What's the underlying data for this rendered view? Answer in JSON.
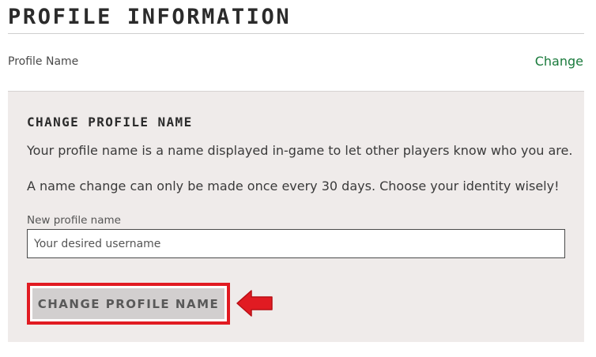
{
  "section": {
    "title": "PROFILE INFORMATION"
  },
  "profile_row": {
    "label": "Profile Name",
    "change_link": "Change"
  },
  "change_panel": {
    "title": "CHANGE PROFILE NAME",
    "description_1": "Your profile name is a name displayed in-game to let other players know who you are.",
    "description_2": "A name change can only be made once every 30 days. Choose your identity wisely!",
    "field_label": "New profile name",
    "input_value": "",
    "input_placeholder": "Your desired username",
    "button_label": "CHANGE PROFILE NAME"
  },
  "colors": {
    "accent_link": "#1a7a3c",
    "panel_background": "#efebea",
    "highlight": "#e11b22"
  },
  "icons": {
    "pointer": "arrow-left-icon"
  }
}
